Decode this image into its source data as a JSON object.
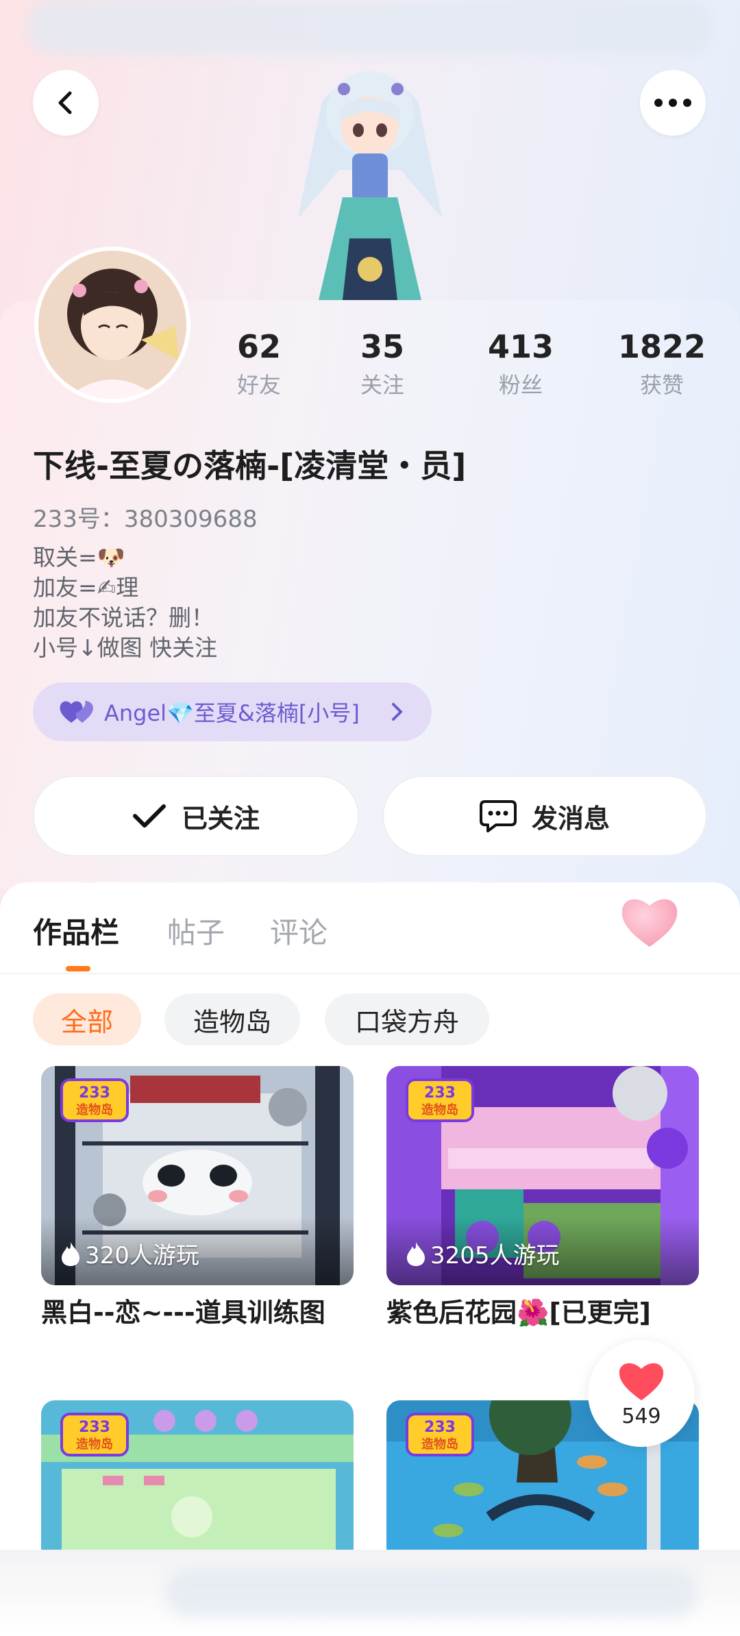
{
  "header": {
    "back_icon": "chevron-left-icon",
    "more_icon": "more-dots-icon"
  },
  "stats": [
    {
      "value": "62",
      "label": "好友"
    },
    {
      "value": "35",
      "label": "关注"
    },
    {
      "value": "413",
      "label": "粉丝"
    },
    {
      "value": "1822",
      "label": "获赞"
    }
  ],
  "profile": {
    "name": "下线-至夏の落楠-[凌清堂・员]",
    "uid": "233号：380309688",
    "bio": [
      "取关=🐶",
      "加友=✍理",
      "加友不说话？删！",
      "小号↓做图 快关注"
    ]
  },
  "alt_account": {
    "label": "Angel💎至夏&落楠[小号]",
    "accent": "#6b5bd0"
  },
  "actions": {
    "follow_label": "已关注",
    "message_label": "发消息"
  },
  "tabs": [
    "作品栏",
    "帖子",
    "评论"
  ],
  "filters": [
    "全部",
    "造物岛",
    "口袋方舟"
  ],
  "works": [
    {
      "title": "黑白--恋~---道具训练图",
      "plays": "320人游玩",
      "brand": "233造物岛"
    },
    {
      "title": "紫色后花园🌺[已更完]",
      "plays": "3205人游玩",
      "brand": "233造物岛"
    },
    {
      "title": "",
      "plays": "",
      "brand": "233造物岛"
    },
    {
      "title": "",
      "plays": "",
      "brand": "233造物岛"
    }
  ],
  "like_float": {
    "count": "549"
  },
  "colors": {
    "accent": "#ff7a1a",
    "heart": "#ff4d5e"
  }
}
